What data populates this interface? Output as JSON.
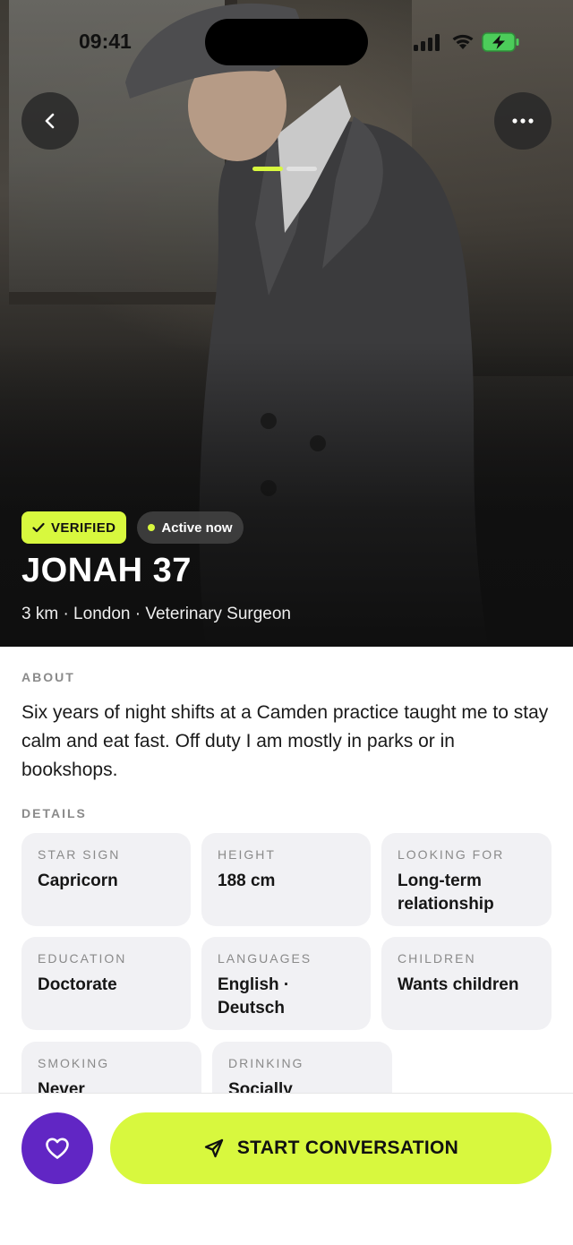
{
  "status_bar": {
    "time": "09:41"
  },
  "profile": {
    "verified_label": "VERIFIED",
    "active_label": "Active now",
    "name": "JONAH 37",
    "subline": "3 km · London · Veterinary Surgeon"
  },
  "about": {
    "label": "ABOUT",
    "text": "Six years of night shifts at a Camden practice taught me to stay calm and eat fast. Off duty I am mostly in parks or in bookshops."
  },
  "details": {
    "label": "DETAILS",
    "items": [
      {
        "key": "STAR SIGN",
        "value": "Capricorn"
      },
      {
        "key": "HEIGHT",
        "value": "188 cm"
      },
      {
        "key": "LOOKING FOR",
        "value": "Long-term relationship"
      },
      {
        "key": "EDUCATION",
        "value": "Doctorate"
      },
      {
        "key": "LANGUAGES",
        "value": "English · Deutsch"
      },
      {
        "key": "CHILDREN",
        "value": "Wants children"
      },
      {
        "key": "SMOKING",
        "value": "Never"
      },
      {
        "key": "DRINKING",
        "value": "Socially"
      }
    ]
  },
  "actions": {
    "cta_label": "START CONVERSATION"
  },
  "icons": {
    "back": "chevron-left-icon",
    "more": "more-horizontal-icon",
    "verified": "check-icon",
    "like": "heart-icon",
    "send": "send-icon"
  },
  "photo_pager": {
    "count": 2,
    "active_index": 0
  },
  "colors": {
    "accent": "#d8f83e",
    "like_button": "#6126c4",
    "card_bg": "#f1f1f4"
  }
}
